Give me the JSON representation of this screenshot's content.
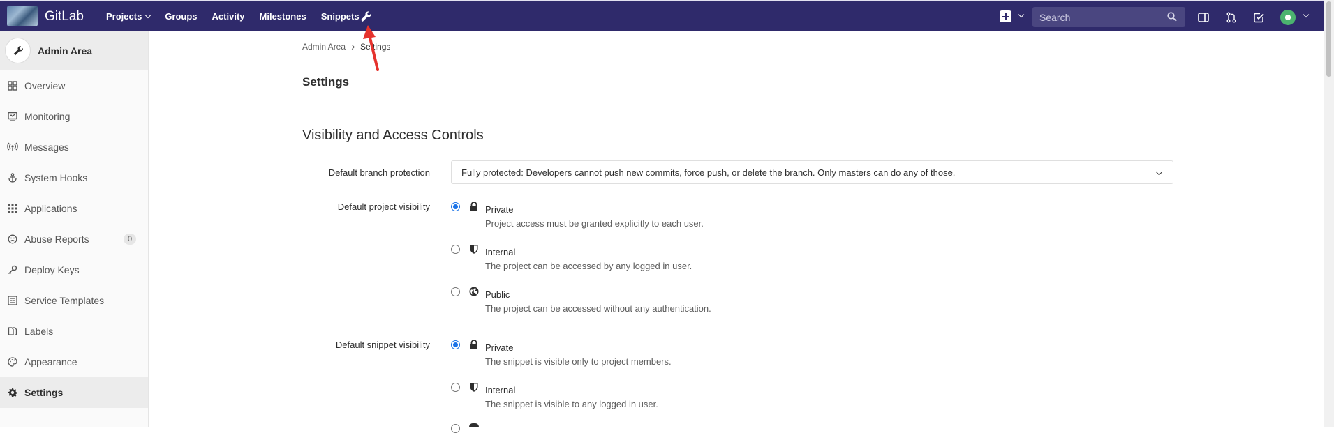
{
  "topbar": {
    "brand": "GitLab",
    "nav": [
      "Projects",
      "Groups",
      "Activity",
      "Milestones",
      "Snippets"
    ],
    "search_placeholder": "Search"
  },
  "sidebar": {
    "title": "Admin Area",
    "items": [
      {
        "label": "Overview",
        "icon": "overview-icon"
      },
      {
        "label": "Monitoring",
        "icon": "monitor-icon"
      },
      {
        "label": "Messages",
        "icon": "broadcast-icon"
      },
      {
        "label": "System Hooks",
        "icon": "anchor-icon"
      },
      {
        "label": "Applications",
        "icon": "grid-icon"
      },
      {
        "label": "Abuse Reports",
        "icon": "abuse-icon",
        "count": "0"
      },
      {
        "label": "Deploy Keys",
        "icon": "key-icon"
      },
      {
        "label": "Service Templates",
        "icon": "template-icon"
      },
      {
        "label": "Labels",
        "icon": "labels-icon"
      },
      {
        "label": "Appearance",
        "icon": "palette-icon"
      },
      {
        "label": "Settings",
        "icon": "gear-icon",
        "active": true
      }
    ]
  },
  "breadcrumb": {
    "root": "Admin Area",
    "current": "Settings"
  },
  "page_title": "Settings",
  "section": {
    "title": "Visibility and Access Controls",
    "branch_protection": {
      "label": "Default branch protection",
      "value": "Fully protected: Developers cannot push new commits, force push, or delete the branch. Only masters can do any of those."
    },
    "project_visibility": {
      "label": "Default project visibility",
      "options": [
        {
          "title": "Private",
          "desc": "Project access must be granted explicitly to each user.",
          "checked": true,
          "icon": "lock-icon"
        },
        {
          "title": "Internal",
          "desc": "The project can be accessed by any logged in user.",
          "checked": false,
          "icon": "shield-icon"
        },
        {
          "title": "Public",
          "desc": "The project can be accessed without any authentication.",
          "checked": false,
          "icon": "globe-icon"
        }
      ]
    },
    "snippet_visibility": {
      "label": "Default snippet visibility",
      "options": [
        {
          "title": "Private",
          "desc": "The snippet is visible only to project members.",
          "checked": true,
          "icon": "lock-icon"
        },
        {
          "title": "Internal",
          "desc": "The snippet is visible to any logged in user.",
          "checked": false,
          "icon": "shield-icon"
        }
      ]
    }
  },
  "colors": {
    "nav_bg": "#2f2a6b",
    "accent_radio": "#1a73e8",
    "annotation_arrow": "#e5322d"
  }
}
